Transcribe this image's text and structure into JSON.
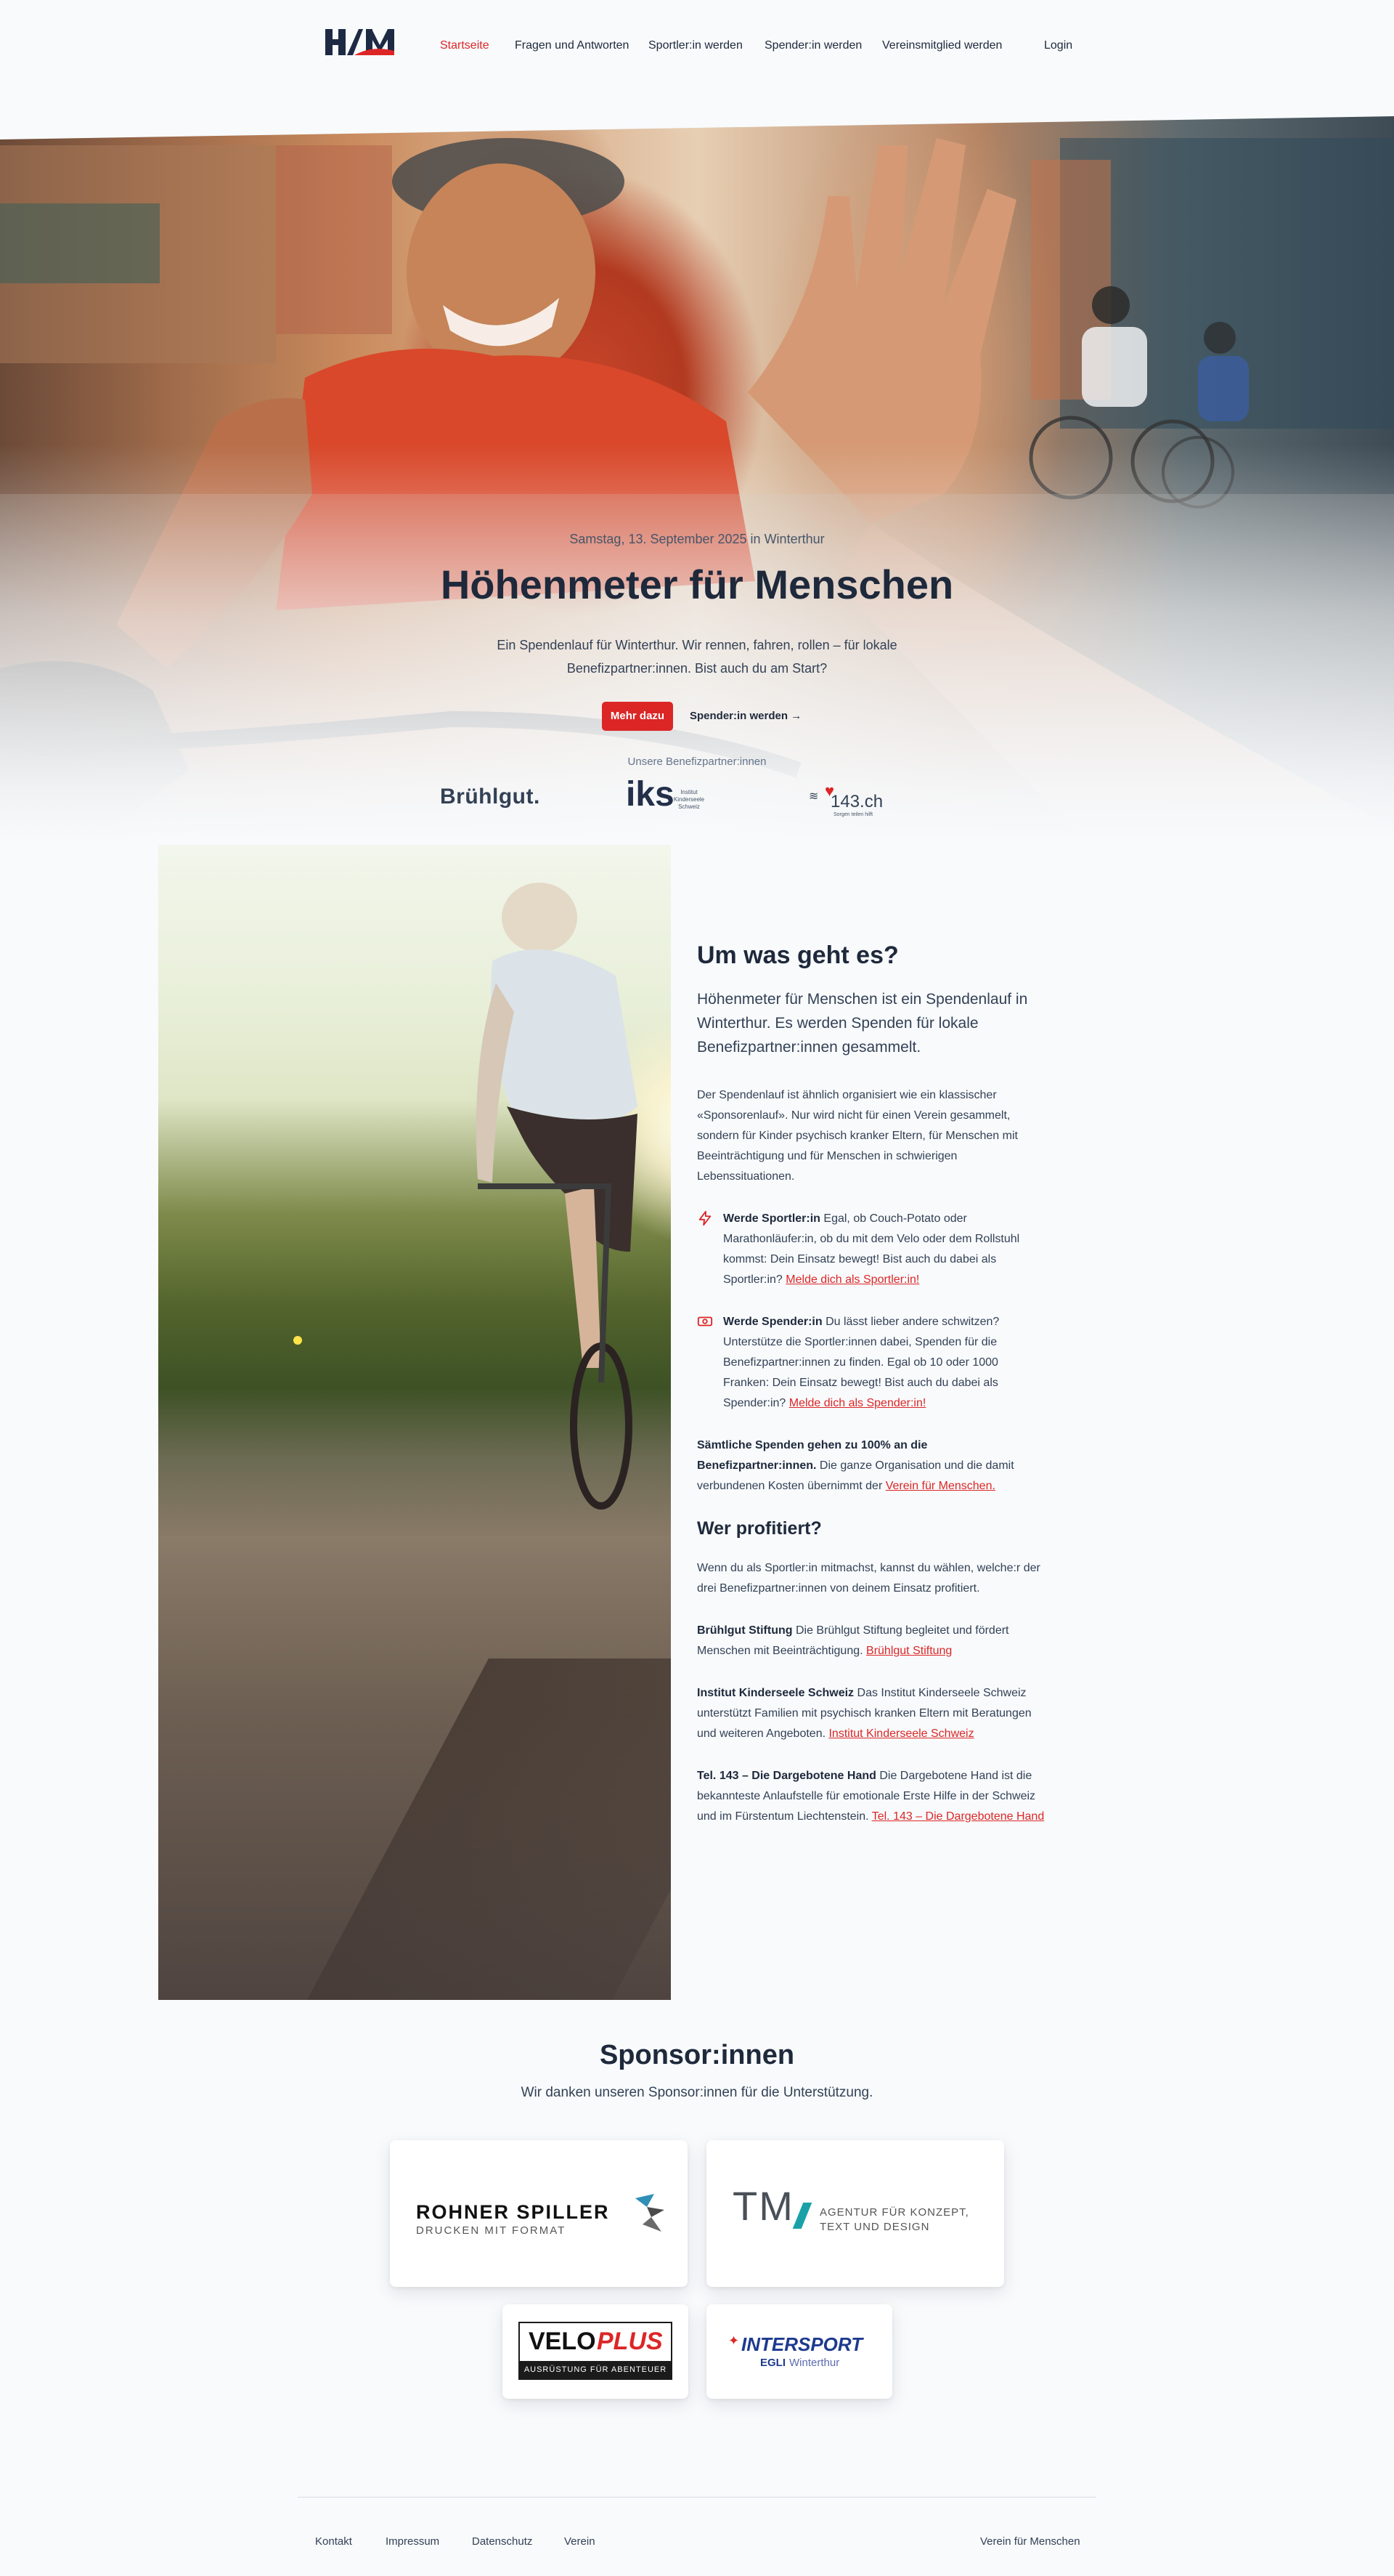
{
  "nav": {
    "logo_text": "HfM",
    "links": [
      "Startseite",
      "Fragen und Antworten",
      "Sportler:in werden",
      "Spender:in werden",
      "Vereinsmitglied werden"
    ],
    "login": "Login"
  },
  "hero": {
    "date": "Samstag, 13. September 2025 in Winterthur",
    "title": "Höhenmeter für Menschen",
    "intro": "Ein Spendenlauf für Winterthur. Wir rennen, fahren, rollen – für lokale Benefizpartner:innen. Bist auch du am Start?",
    "cta_primary": "Mehr dazu",
    "cta_secondary": "Spender:in werden →",
    "partners_label": "Unsere Benefizpartner:innen",
    "partners": [
      {
        "name": "Brühlgut."
      },
      {
        "name": "iks",
        "sub": "Institut Kinderseele Schweiz"
      },
      {
        "name": "143.ch",
        "sub": "Sorgen teilen hilft"
      }
    ]
  },
  "about": {
    "title": "Um was geht es?",
    "lead": "Höhenmeter für Menschen ist ein Spendenlauf in Winterthur. Es werden Spenden für lokale Benefizpartner:innen gesammelt.",
    "body": "Der Spendenlauf ist ähnlich organisiert wie ein klassischer «Sponsorenlauf». Nur wird nicht für einen Verein gesammelt, sondern für Kinder psychisch kranker Eltern, für Menschen mit Beeinträchtigung und für Menschen in schwierigen Lebenssituationen.",
    "feature1": {
      "icon": "lightning-icon",
      "title": "Werde Sportler:in",
      "text": "Egal, ob Couch-Potato oder Marathonläufer:in, ob du mit dem Velo oder dem Rollstuhl kommst: Dein Einsatz bewegt! Bist auch du dabei als Sportler:in?",
      "link": "Melde dich als Sportler:in!"
    },
    "feature2": {
      "icon": "banknote-icon",
      "title": "Werde Spender:in",
      "text": "Du lässt lieber andere schwitzen? Unterstütze die Sportler:innen dabei, Spenden für die Benefizpartner:innen zu finden. Egal ob 10 oder 1000 Franken: Dein Einsatz bewegt! Bist auch du dabei als Spender:in?",
      "link": "Melde dich als Spender:in!"
    },
    "note_bold": "Sämtliche Spenden gehen zu 100% an die Benefizpartner:innen.",
    "note_text": "Die ganze Organisation und die damit verbundenen Kosten übernimmt der",
    "note_link": "Verein für Menschen."
  },
  "benefit": {
    "title": "Wer profitiert?",
    "intro": "Wenn du als Sportler:in mitmachst, kannst du wählen, welche:r der drei Benefizpartner:innen von deinem Einsatz profitiert.",
    "partners": [
      {
        "name": "Brühlgut Stiftung",
        "text": "Die Brühlgut Stiftung begleitet und fördert Menschen mit Beeinträchtigung.",
        "link": "Brühlgut Stiftung"
      },
      {
        "name": "Institut Kinderseele Schweiz",
        "text": "Das Institut Kinderseele Schweiz unterstützt Familien mit psychisch kranken Eltern mit Beratungen und weiteren Angeboten.",
        "link": "Institut Kinderseele Schweiz"
      },
      {
        "name": "Tel. 143 – Die Dargebotene Hand",
        "text": "Die Dargebotene Hand ist die bekannteste Anlaufstelle für emotionale Erste Hilfe in der Schweiz und im Fürstentum Liechtenstein.",
        "link": "Tel. 143 – Die Dargebotene Hand"
      }
    ]
  },
  "sponsors": {
    "title": "Sponsor:innen",
    "subtitle": "Wir danken unseren Sponsor:innen für die Unterstützung.",
    "items": [
      {
        "name": "ROHNER SPILLER",
        "sub": "DRUCKEN MIT FORMAT"
      },
      {
        "name": "TM",
        "sub": "AGENTUR FÜR KONZEPT, TEXT UND DESIGN"
      },
      {
        "name_a": "VELO",
        "name_b": "PLUS",
        "sub": "AUSRÜSTUNG FÜR ABENTEUER"
      },
      {
        "name": "INTERSPORT",
        "sub_a": "EGLI",
        "sub_b": "Winterthur"
      }
    ]
  },
  "footer": {
    "links": [
      "Kontakt",
      "Impressum",
      "Datenschutz",
      "Verein"
    ],
    "right": "Verein für Menschen"
  },
  "colors": {
    "accent": "#dc2626",
    "text": "#1e293b",
    "background": "#f8fafc"
  }
}
